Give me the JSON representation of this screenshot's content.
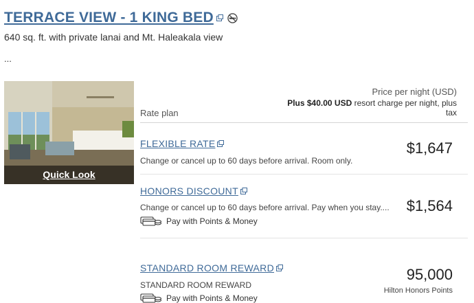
{
  "room": {
    "title": "TERRACE VIEW - 1 KING BED",
    "description": "640 sq. ft. with private lanai and Mt. Haleakala view",
    "more": "...",
    "quick_look": "Quick Look"
  },
  "table": {
    "rate_plan_label": "Rate plan",
    "price_per_night": "Price per night (USD)",
    "resort_charge_bold": "Plus $40.00 USD",
    "resort_charge_rest": " resort charge per night, plus tax"
  },
  "rates": [
    {
      "name": "FLEXIBLE RATE",
      "description": "Change or cancel up to 60 days before arrival. Room only.",
      "price": "$1,647"
    },
    {
      "name": "HONORS DISCOUNT",
      "description": "Change or cancel up to 60 days before arrival. Pay when you stay....",
      "points_money": "Pay with Points & Money",
      "price": "$1,564"
    },
    {
      "name": "STANDARD ROOM REWARD",
      "description": "STANDARD ROOM REWARD",
      "points_money": "Pay with Points & Money",
      "price": "95,000",
      "price_sub": "Hilton Honors Points"
    }
  ],
  "colors": {
    "link": "#3f6a98",
    "divider": "#d4d4d4"
  }
}
